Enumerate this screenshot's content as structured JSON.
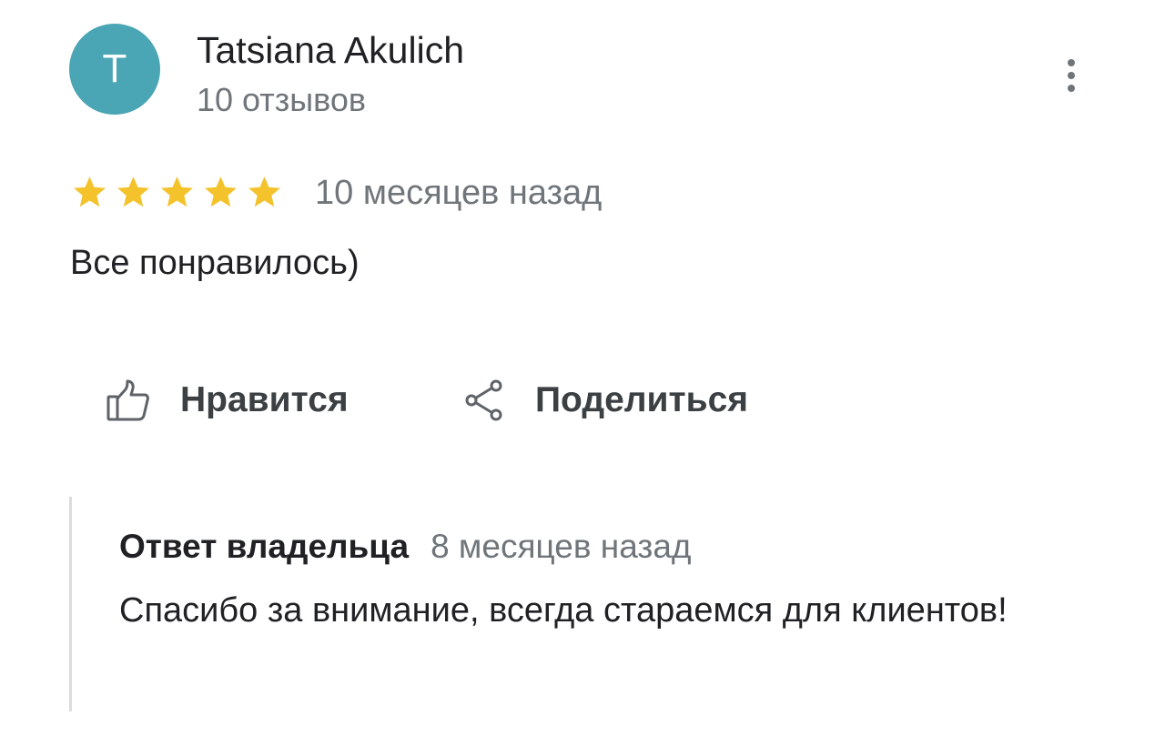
{
  "review": {
    "author": {
      "initial": "T",
      "name": "Tatsiana Akulich",
      "reviews_count": "10 отзывов",
      "avatar_color": "#4aa5b4"
    },
    "menu_icon": "more-vert-icon",
    "rating": 5,
    "rating_max": 5,
    "star_color": "#f4c22b",
    "time": "10 месяцев назад",
    "text": "Все понравилось)"
  },
  "actions": {
    "like": {
      "label": "Нравится",
      "icon": "thumbs-up-icon"
    },
    "share": {
      "label": "Поделиться",
      "icon": "share-icon"
    }
  },
  "owner_reply": {
    "title": "Ответ владельца",
    "time": "8 месяцев назад",
    "text": "Спасибо за внимание, всегда стараемся для клиентов!"
  }
}
